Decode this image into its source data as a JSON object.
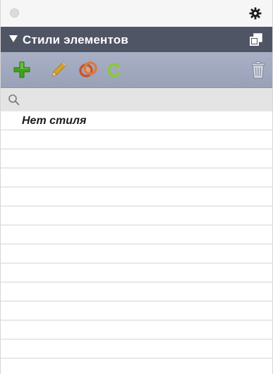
{
  "panel": {
    "header_title": "Стили элементов"
  },
  "search": {
    "value": "",
    "placeholder": ""
  },
  "styles_list": {
    "items": [
      "Нет стиля"
    ]
  },
  "icons": {
    "titlebar": [
      "close-dot",
      "gear-icon"
    ],
    "header": [
      "disclosure-triangle-icon",
      "detach-panel-icon"
    ],
    "toolbar": [
      "add-icon",
      "edit-pencil-icon",
      "link-icon",
      "redo-icon",
      "trash-icon"
    ],
    "search": "search-icon"
  },
  "colors": {
    "header_bg": "#4f5565",
    "toolbar_bg": "#a3aac0",
    "add_green": "#3fa31a",
    "pencil_gold": "#d5a32b",
    "link_orange": "#c4562d"
  }
}
